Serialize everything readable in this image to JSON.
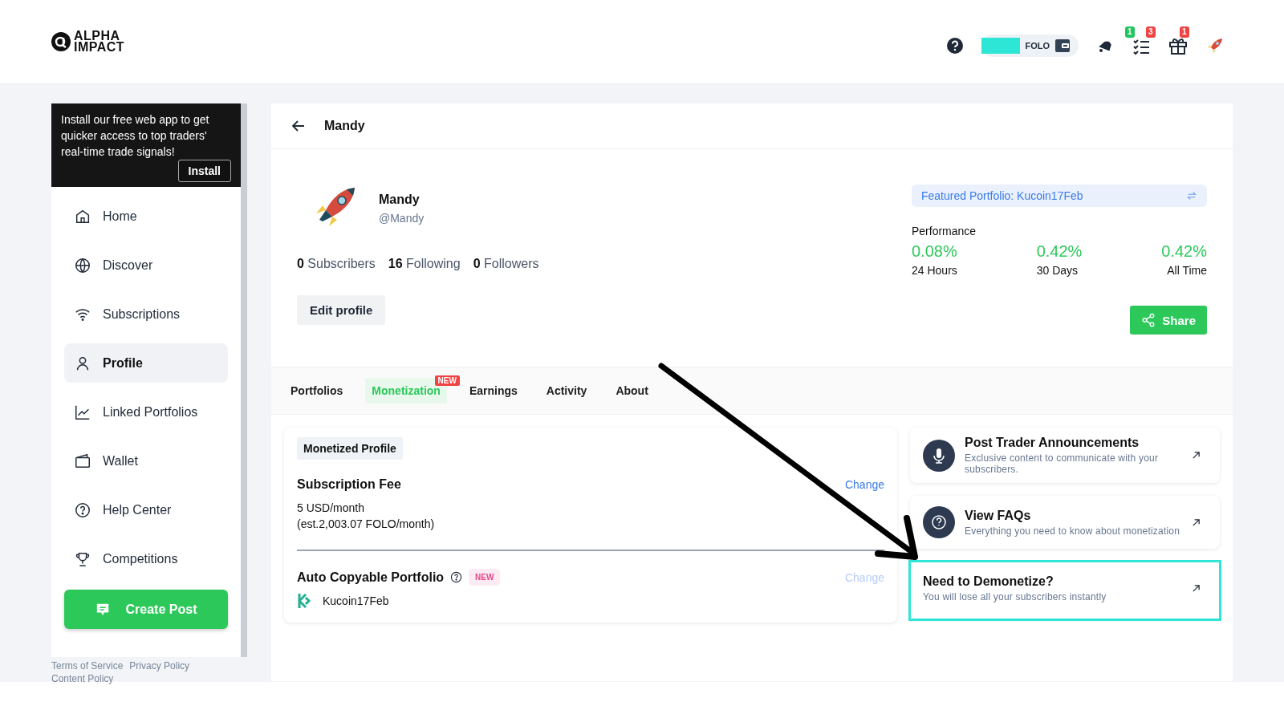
{
  "header": {
    "logo": "ALPHA IMPACT",
    "wallet": {
      "label": "FOLO"
    },
    "badges": [
      {
        "count": "1",
        "color": "#22c55e"
      },
      {
        "count": "3",
        "color": "#ef4444"
      },
      {
        "count": "1",
        "color": "#ef4444"
      }
    ]
  },
  "install_banner": {
    "text": "Install our free web app to get quicker access to top traders' real-time trade signals!",
    "button": "Install"
  },
  "sidebar": {
    "items": [
      {
        "label": "Home",
        "selected": false
      },
      {
        "label": "Discover",
        "selected": false
      },
      {
        "label": "Subscriptions",
        "selected": false
      },
      {
        "label": "Profile",
        "selected": true
      },
      {
        "label": "Linked Portfolios",
        "selected": false
      },
      {
        "label": "Wallet",
        "selected": false
      },
      {
        "label": "Help Center",
        "selected": false
      },
      {
        "label": "Competitions",
        "selected": false
      }
    ],
    "create_button": "Create Post",
    "footer_links": [
      "Terms of Service",
      "Privacy Policy",
      "Content Policy"
    ]
  },
  "page": {
    "title": "Mandy"
  },
  "profile": {
    "name": "Mandy",
    "handle": "@Mandy",
    "stats": [
      "**0** Subscribers",
      "**16** Following",
      "**0** Followers"
    ],
    "edit_button": "Edit profile",
    "share_button": "Share"
  },
  "featured": {
    "text": "Featured Portfolio: Kucoin17Feb"
  },
  "performance": {
    "title": "Performance",
    "items": [
      {
        "value": "0.08%",
        "label": "24 Hours"
      },
      {
        "value": "0.42%",
        "label": "30 Days"
      },
      {
        "value": "0.42%",
        "label": "All Time"
      }
    ]
  },
  "tabs": [
    {
      "label": "Portfolios",
      "selected": false
    },
    {
      "label": "Monetization",
      "selected": true,
      "badge": "NEW"
    },
    {
      "label": "Earnings",
      "selected": false
    },
    {
      "label": "Activity",
      "selected": false
    },
    {
      "label": "About",
      "selected": false
    }
  ],
  "monetization": {
    "tag": "Monetized Profile",
    "fee": {
      "title": "Subscription Fee",
      "action": "Change",
      "disabled": false,
      "lines": [
        "5 USD/month",
        "(est.2,003.07 FOLO/month)"
      ]
    },
    "auto_copy": {
      "title": "Auto Copyable Portfolio",
      "badge": "NEW",
      "action": "Change",
      "disabled": true,
      "portfolio": "Kucoin17Feb"
    }
  },
  "actions": [
    {
      "title": "Post Trader Announcements",
      "text": "Exclusive content to communicate with your subscribers.",
      "highlighted": false
    },
    {
      "title": "View FAQs",
      "text": "Everything you need to know about monetization",
      "highlighted": false
    },
    {
      "title": "Need to Demonetize?",
      "text": "You will lose all your subscribers instantly",
      "highlighted": true
    }
  ]
}
